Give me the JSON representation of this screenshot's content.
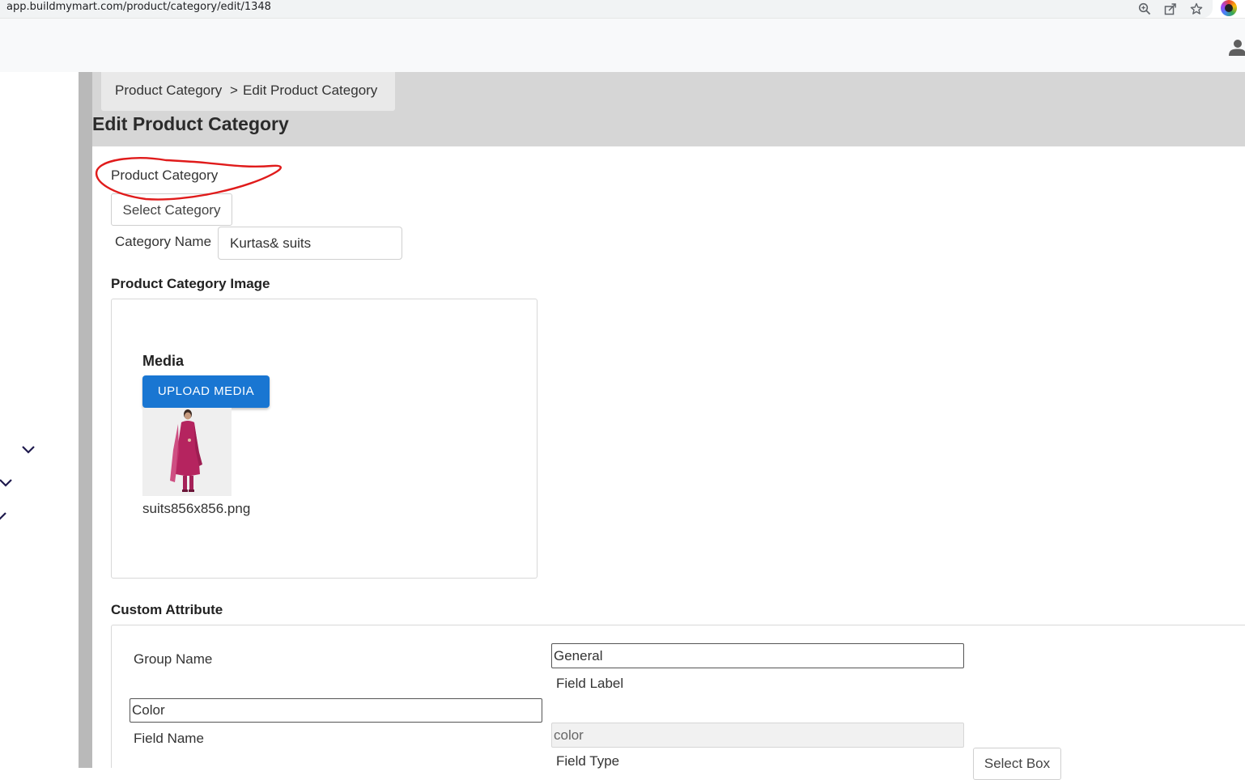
{
  "browser": {
    "url": "app.buildmymart.com/product/category/edit/1348",
    "icons": [
      "zoom-icon",
      "share-icon",
      "bookmark-star-icon",
      "extension-icon"
    ]
  },
  "header": {
    "user_icon": "user-icon"
  },
  "breadcrumb": {
    "items": [
      "Product Category",
      "Edit Product Category"
    ],
    "separator": ">"
  },
  "page": {
    "title": "Edit Product Category"
  },
  "form": {
    "product_category_label": "Product Category",
    "select_category_button": "Select Category",
    "category_name_label": "Category Name",
    "category_name_value": "Kurtas& suits",
    "image_section_title": "Product Category Image",
    "media_title": "Media",
    "upload_button": "UPLOAD MEDIA",
    "image_filename": "suits856x856.png"
  },
  "custom_attribute": {
    "section_title": "Custom Attribute",
    "group_name_label": "Group Name",
    "group_name_value": "General",
    "field_label_label": "Field Label",
    "field_label_value": "Color",
    "field_name_label": "Field Name",
    "field_name_value": "color",
    "field_type_label": "Field Type",
    "field_type_value": "Select Box"
  },
  "colors": {
    "primary_button": "#1976d2",
    "annotation": "#e01b1b",
    "sidebar_accent": "#1f1a4d"
  }
}
